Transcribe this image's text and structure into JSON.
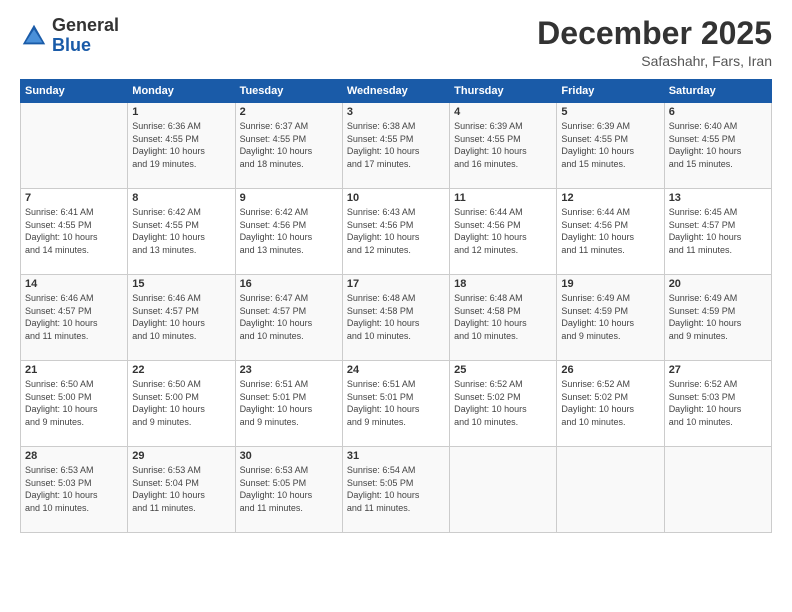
{
  "logo": {
    "general": "General",
    "blue": "Blue"
  },
  "header": {
    "month": "December 2025",
    "location": "Safashahr, Fars, Iran"
  },
  "weekdays": [
    "Sunday",
    "Monday",
    "Tuesday",
    "Wednesday",
    "Thursday",
    "Friday",
    "Saturday"
  ],
  "weeks": [
    [
      {
        "day": "",
        "content": ""
      },
      {
        "day": "1",
        "content": "Sunrise: 6:36 AM\nSunset: 4:55 PM\nDaylight: 10 hours\nand 19 minutes."
      },
      {
        "day": "2",
        "content": "Sunrise: 6:37 AM\nSunset: 4:55 PM\nDaylight: 10 hours\nand 18 minutes."
      },
      {
        "day": "3",
        "content": "Sunrise: 6:38 AM\nSunset: 4:55 PM\nDaylight: 10 hours\nand 17 minutes."
      },
      {
        "day": "4",
        "content": "Sunrise: 6:39 AM\nSunset: 4:55 PM\nDaylight: 10 hours\nand 16 minutes."
      },
      {
        "day": "5",
        "content": "Sunrise: 6:39 AM\nSunset: 4:55 PM\nDaylight: 10 hours\nand 15 minutes."
      },
      {
        "day": "6",
        "content": "Sunrise: 6:40 AM\nSunset: 4:55 PM\nDaylight: 10 hours\nand 15 minutes."
      }
    ],
    [
      {
        "day": "7",
        "content": "Sunrise: 6:41 AM\nSunset: 4:55 PM\nDaylight: 10 hours\nand 14 minutes."
      },
      {
        "day": "8",
        "content": "Sunrise: 6:42 AM\nSunset: 4:55 PM\nDaylight: 10 hours\nand 13 minutes."
      },
      {
        "day": "9",
        "content": "Sunrise: 6:42 AM\nSunset: 4:56 PM\nDaylight: 10 hours\nand 13 minutes."
      },
      {
        "day": "10",
        "content": "Sunrise: 6:43 AM\nSunset: 4:56 PM\nDaylight: 10 hours\nand 12 minutes."
      },
      {
        "day": "11",
        "content": "Sunrise: 6:44 AM\nSunset: 4:56 PM\nDaylight: 10 hours\nand 12 minutes."
      },
      {
        "day": "12",
        "content": "Sunrise: 6:44 AM\nSunset: 4:56 PM\nDaylight: 10 hours\nand 11 minutes."
      },
      {
        "day": "13",
        "content": "Sunrise: 6:45 AM\nSunset: 4:57 PM\nDaylight: 10 hours\nand 11 minutes."
      }
    ],
    [
      {
        "day": "14",
        "content": "Sunrise: 6:46 AM\nSunset: 4:57 PM\nDaylight: 10 hours\nand 11 minutes."
      },
      {
        "day": "15",
        "content": "Sunrise: 6:46 AM\nSunset: 4:57 PM\nDaylight: 10 hours\nand 10 minutes."
      },
      {
        "day": "16",
        "content": "Sunrise: 6:47 AM\nSunset: 4:57 PM\nDaylight: 10 hours\nand 10 minutes."
      },
      {
        "day": "17",
        "content": "Sunrise: 6:48 AM\nSunset: 4:58 PM\nDaylight: 10 hours\nand 10 minutes."
      },
      {
        "day": "18",
        "content": "Sunrise: 6:48 AM\nSunset: 4:58 PM\nDaylight: 10 hours\nand 10 minutes."
      },
      {
        "day": "19",
        "content": "Sunrise: 6:49 AM\nSunset: 4:59 PM\nDaylight: 10 hours\nand 9 minutes."
      },
      {
        "day": "20",
        "content": "Sunrise: 6:49 AM\nSunset: 4:59 PM\nDaylight: 10 hours\nand 9 minutes."
      }
    ],
    [
      {
        "day": "21",
        "content": "Sunrise: 6:50 AM\nSunset: 5:00 PM\nDaylight: 10 hours\nand 9 minutes."
      },
      {
        "day": "22",
        "content": "Sunrise: 6:50 AM\nSunset: 5:00 PM\nDaylight: 10 hours\nand 9 minutes."
      },
      {
        "day": "23",
        "content": "Sunrise: 6:51 AM\nSunset: 5:01 PM\nDaylight: 10 hours\nand 9 minutes."
      },
      {
        "day": "24",
        "content": "Sunrise: 6:51 AM\nSunset: 5:01 PM\nDaylight: 10 hours\nand 9 minutes."
      },
      {
        "day": "25",
        "content": "Sunrise: 6:52 AM\nSunset: 5:02 PM\nDaylight: 10 hours\nand 10 minutes."
      },
      {
        "day": "26",
        "content": "Sunrise: 6:52 AM\nSunset: 5:02 PM\nDaylight: 10 hours\nand 10 minutes."
      },
      {
        "day": "27",
        "content": "Sunrise: 6:52 AM\nSunset: 5:03 PM\nDaylight: 10 hours\nand 10 minutes."
      }
    ],
    [
      {
        "day": "28",
        "content": "Sunrise: 6:53 AM\nSunset: 5:03 PM\nDaylight: 10 hours\nand 10 minutes."
      },
      {
        "day": "29",
        "content": "Sunrise: 6:53 AM\nSunset: 5:04 PM\nDaylight: 10 hours\nand 11 minutes."
      },
      {
        "day": "30",
        "content": "Sunrise: 6:53 AM\nSunset: 5:05 PM\nDaylight: 10 hours\nand 11 minutes."
      },
      {
        "day": "31",
        "content": "Sunrise: 6:54 AM\nSunset: 5:05 PM\nDaylight: 10 hours\nand 11 minutes."
      },
      {
        "day": "",
        "content": ""
      },
      {
        "day": "",
        "content": ""
      },
      {
        "day": "",
        "content": ""
      }
    ]
  ]
}
